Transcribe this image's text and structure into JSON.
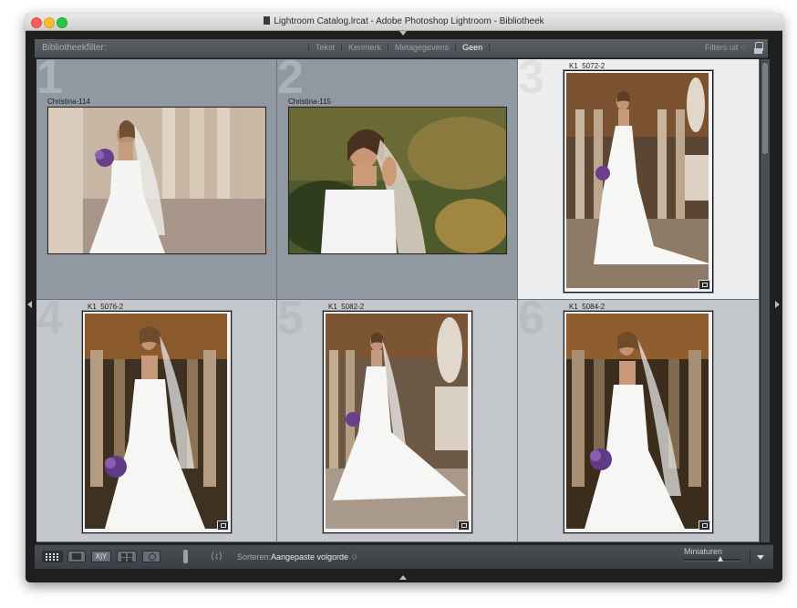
{
  "window": {
    "title": "Lightroom Catalog.lrcat - Adobe Photoshop Lightroom - Bibliotheek"
  },
  "filter_bar": {
    "label": "Bibliotheekfilter:",
    "tabs": [
      "Tekst",
      "Kenmerk",
      "Metagegevens",
      "Geen"
    ],
    "active_tab": "Geen",
    "filters_menu": "Filters uit ♢"
  },
  "grid": {
    "cells": [
      {
        "index": "1",
        "filename": "Christina-114",
        "state": "selected",
        "orientation": "landscape"
      },
      {
        "index": "2",
        "filename": "Christina-115",
        "state": "selected",
        "orientation": "landscape"
      },
      {
        "index": "3",
        "filename": "K1_5072-2",
        "state": "highlighted",
        "orientation": "portrait",
        "has_badge": true
      },
      {
        "index": "4",
        "filename": "K1_5076-2",
        "state": "normal",
        "orientation": "portrait",
        "has_badge": true
      },
      {
        "index": "5",
        "filename": "K1_5082-2",
        "state": "normal",
        "orientation": "portrait",
        "has_badge": true
      },
      {
        "index": "6",
        "filename": "K1_5084-2",
        "state": "normal",
        "orientation": "portrait",
        "has_badge": true
      }
    ]
  },
  "toolbar": {
    "xy_label": "X|Y",
    "sort_label": "Sorteren:",
    "sort_value": "Aangepaste volgorde ♢",
    "thumbnails_label": "Miniaturen",
    "thumbnail_size": 0.65
  },
  "colors": {
    "selected_cell": "#9098a1",
    "normal_cell": "#c4c8cc",
    "highlighted_cell": "#eceeef",
    "toolbar": "#44484d"
  },
  "icons": [
    "grid-view-icon",
    "loupe-view-icon",
    "compare-view-icon",
    "survey-view-icon",
    "people-view-icon",
    "painter-icon",
    "sort-direction-icon",
    "lock-icon",
    "disclosure-arrow-icon"
  ]
}
